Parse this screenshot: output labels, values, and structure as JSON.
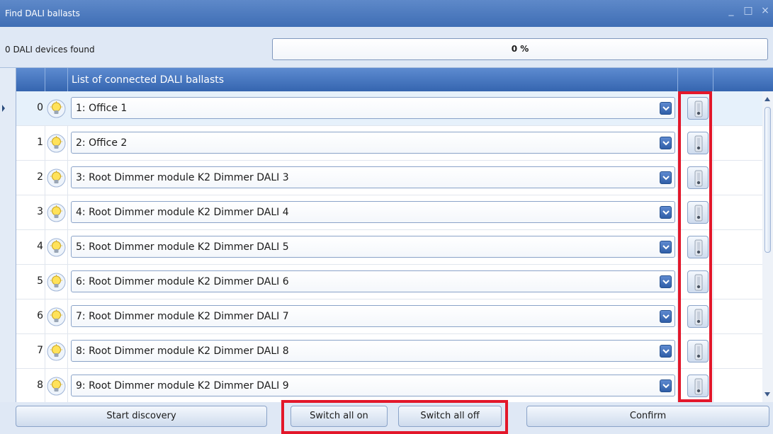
{
  "window": {
    "title": "Find DALI ballasts",
    "controls": [
      "minimize",
      "maximize",
      "close"
    ]
  },
  "status": {
    "found_text": "0 DALI devices found",
    "progress_text": "0 %",
    "progress_value": 0
  },
  "grid": {
    "header": "List of connected DALI ballasts",
    "rows": [
      {
        "index": "0",
        "ballast": "1: Office 1",
        "selected": true
      },
      {
        "index": "1",
        "ballast": "2: Office 2"
      },
      {
        "index": "2",
        "ballast": "3: Root Dimmer module K2 Dimmer DALI 3"
      },
      {
        "index": "3",
        "ballast": "4: Root Dimmer module K2 Dimmer DALI 4"
      },
      {
        "index": "4",
        "ballast": "5: Root Dimmer module K2 Dimmer DALI 5"
      },
      {
        "index": "5",
        "ballast": "6: Root Dimmer module K2 Dimmer DALI 6"
      },
      {
        "index": "6",
        "ballast": "7: Root Dimmer module K2 Dimmer DALI 7"
      },
      {
        "index": "7",
        "ballast": "8: Root Dimmer module K2 Dimmer DALI 8"
      },
      {
        "index": "8",
        "ballast": "9: Root Dimmer module K2 Dimmer DALI 9"
      }
    ]
  },
  "footer": {
    "start_discovery": "Start discovery",
    "switch_all_on": "Switch all on",
    "switch_all_off": "Switch all off",
    "confirm": "Confirm"
  },
  "icons": {
    "row_icon": "lightbulb-icon",
    "switch_icon": "light-switch-icon",
    "dropdown_icon": "chevron-down-icon"
  },
  "colors": {
    "title_bar": "#4a78bf",
    "header": "#3f6db5",
    "highlight": "#e3172a",
    "selected_row": "#e6f1fb"
  }
}
